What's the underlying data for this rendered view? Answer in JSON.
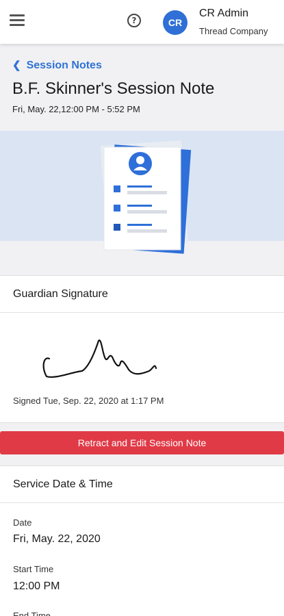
{
  "topbar": {
    "menu_icon": "hamburger-menu-icon",
    "help_icon": "question-circle-icon",
    "help_glyph": "?",
    "avatar_initials": "CR",
    "avatar_color": "#2f6fd6",
    "user_name": "CR Admin",
    "company": "Thread Company"
  },
  "header": {
    "back_label": "Session Notes",
    "back_icon": "chevron-left-icon",
    "title": "B.F. Skinner's Session Note",
    "subtitle": "Fri, May. 22,12:00 PM - 5:52 PM"
  },
  "banner": {
    "illustration_icon": "session-note-document-illustration",
    "background_color": "#dae4f3"
  },
  "guardian_signature": {
    "heading": "Guardian Signature",
    "signed_text": "Signed Tue, Sep. 22, 2020 at 1:17 PM"
  },
  "retract_button": {
    "label": "Retract and Edit Session Note",
    "color": "#e03a47"
  },
  "service": {
    "heading": "Service Date & Time",
    "date_label": "Date",
    "date_value": "Fri, May. 22, 2020",
    "start_label": "Start Time",
    "start_value": "12:00 PM",
    "end_label": "End Time"
  },
  "accent_color": "#2f72d6"
}
